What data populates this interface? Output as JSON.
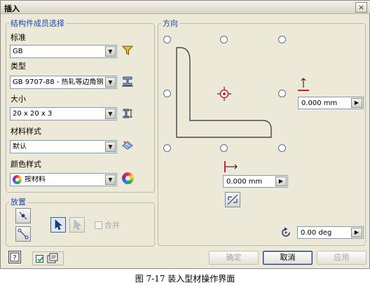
{
  "window": {
    "title": "插入",
    "close_glyph": "×"
  },
  "member_group": {
    "label": "结构件成员选择",
    "standard": {
      "label": "标准",
      "value": "GB"
    },
    "type": {
      "label": "类型",
      "value": "GB 9707-88 - 热轧等边角钢"
    },
    "size": {
      "label": "大小",
      "value": "20 x 20 x 3"
    },
    "material_style": {
      "label": "材料样式",
      "value": "默认"
    },
    "color_style": {
      "label": "颜色样式",
      "value": "按材料"
    }
  },
  "direction_group": {
    "label": "方向",
    "vertical_offset": "0.000 mm",
    "horizontal_offset": "0.000 mm",
    "rotation": "0.00 deg"
  },
  "placement_group": {
    "label": "放置",
    "merge_label": "合并"
  },
  "buttons": {
    "ok": "确定",
    "cancel": "取消",
    "apply": "应用"
  },
  "caption": "图 7-17  装入型材操作界面",
  "icons": [
    "filter-icon",
    "beam-type-icon",
    "size-icon",
    "material-style-icon",
    "color-wheel-icon",
    "arrow-up-icon",
    "arrow-right-icon",
    "rotate-icon",
    "flip-icon",
    "help-icon",
    "pointer-icon"
  ]
}
